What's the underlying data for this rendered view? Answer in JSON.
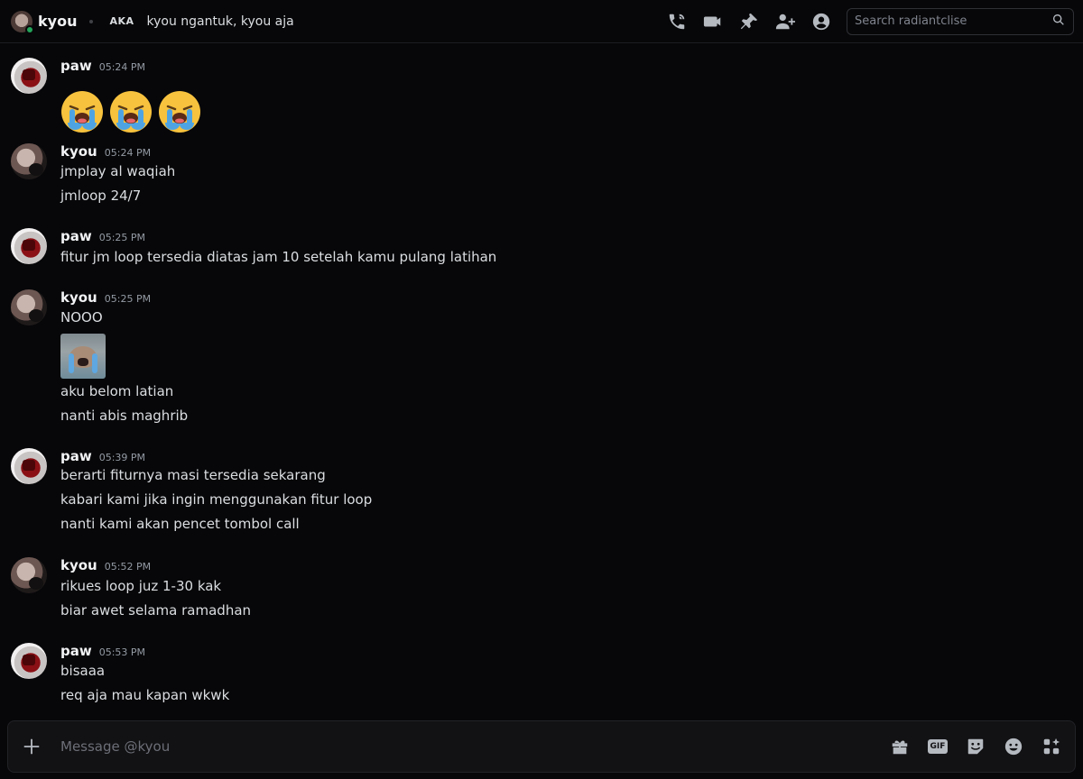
{
  "header": {
    "dm_name": "kyou",
    "aka_label": "AKA",
    "nicknames": "kyou ngantuk, kyou aja",
    "icons": [
      "phone-call-icon",
      "video-call-icon",
      "pin-icon",
      "add-friend-icon",
      "profile-icon"
    ],
    "search_placeholder": "Search radiantclise"
  },
  "messages": [
    {
      "author": "paw",
      "time": "05:24 PM",
      "emoji": [
        "loudly-crying-face",
        "loudly-crying-face",
        "loudly-crying-face"
      ]
    },
    {
      "author": "kyou",
      "time": "05:24 PM",
      "lines": [
        "jmplay al waqiah",
        "jmloop 24/7"
      ]
    },
    {
      "author": "paw",
      "time": "05:25 PM",
      "lines": [
        "fitur jm loop tersedia diatas jam 10 setelah kamu pulang latihan"
      ]
    },
    {
      "author": "kyou",
      "time": "05:25 PM",
      "lines": [
        "NOOO",
        "aku belom latian",
        "nanti abis maghrib"
      ],
      "sticker": "crying-sticker"
    },
    {
      "author": "paw",
      "time": "05:39 PM",
      "lines": [
        "berarti fiturnya masi tersedia sekarang",
        "kabari kami jika ingin menggunakan fitur loop",
        "nanti kami akan pencet tombol call"
      ]
    },
    {
      "author": "kyou",
      "time": "05:52 PM",
      "lines": [
        "rikues loop juz 1-30 kak",
        "biar awet selama ramadhan"
      ]
    },
    {
      "author": "paw",
      "time": "05:53 PM",
      "lines": [
        "bisaaa",
        "req aja mau kapan wkwk"
      ]
    }
  ],
  "composer": {
    "placeholder": "Message @kyou",
    "gif_label": "GIF",
    "icons": [
      "gift-icon",
      "gif-icon",
      "sticker-icon",
      "emoji-icon",
      "apps-icon"
    ]
  },
  "colors": {
    "background": "#070709",
    "text": "#dbdee1",
    "muted": "#949ba4",
    "online": "#23a55a"
  }
}
